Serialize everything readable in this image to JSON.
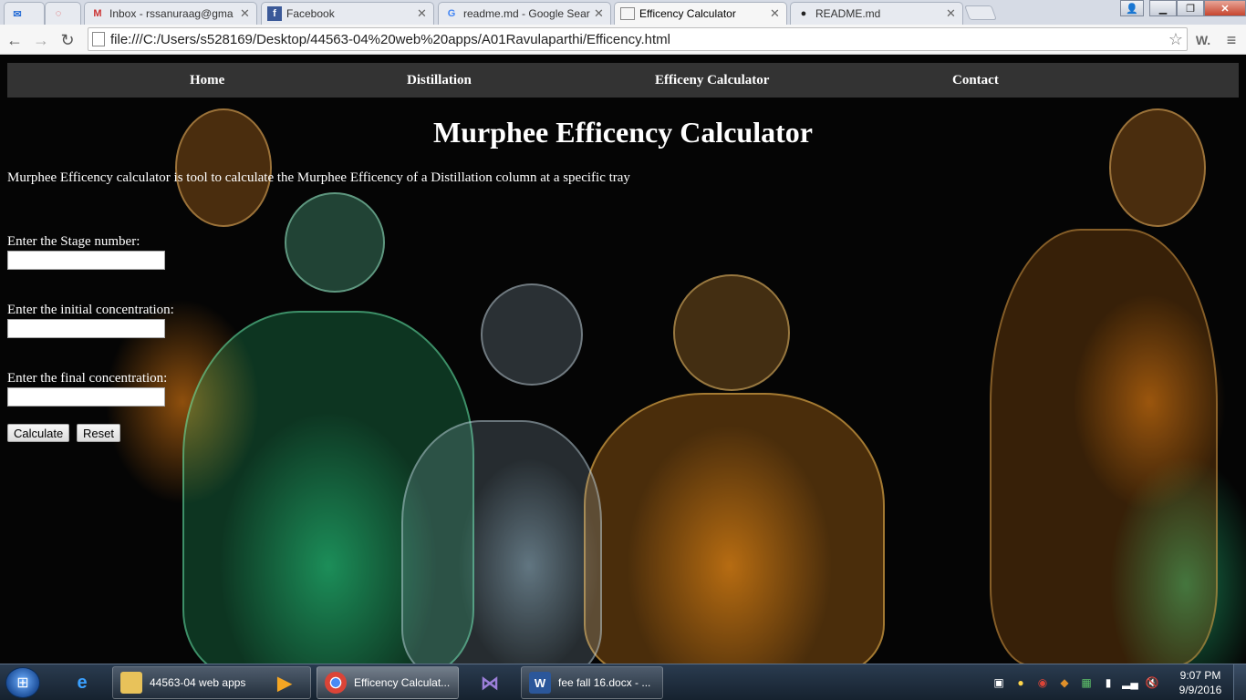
{
  "browser": {
    "tabs": [
      {
        "label": "",
        "icon": "mail-icon"
      },
      {
        "label": "",
        "icon": "loading-icon"
      },
      {
        "label": "Inbox - rssanuraag@gma",
        "icon": "gmail-icon"
      },
      {
        "label": "Facebook",
        "icon": "facebook-icon"
      },
      {
        "label": "readme.md - Google Sear",
        "icon": "google-icon"
      },
      {
        "label": "Efficency Calculator",
        "icon": "page-icon",
        "active": true
      },
      {
        "label": "README.md",
        "icon": "github-icon"
      }
    ],
    "url": "file:///C:/Users/s528169/Desktop/44563-04%20web%20apps/A01Ravulaparthi/Efficency.html",
    "extension_label": "W."
  },
  "nav": {
    "items": [
      "Home",
      "Distillation",
      "Efficeny Calculator",
      "Contact"
    ]
  },
  "page": {
    "title": "Murphee Efficency Calculator",
    "intro": "Murphee Efficency calculator is tool to calculate the Murphee Efficency of a Distillation column at a specific tray",
    "fields": [
      {
        "label": "Enter the Stage number:",
        "value": ""
      },
      {
        "label": "Enter the initial concentration:",
        "value": ""
      },
      {
        "label": "Enter the final concentration:",
        "value": ""
      }
    ],
    "calculate_label": "Calculate",
    "reset_label": "Reset"
  },
  "taskbar": {
    "items": [
      {
        "label": "44563-04 web apps",
        "icon": "folder-icon"
      },
      {
        "label": "Efficency Calculat...",
        "icon": "chrome-icon",
        "active": true
      },
      {
        "label": "fee fall 16.docx - ...",
        "icon": "word-icon"
      }
    ],
    "time": "9:07 PM",
    "date": "9/9/2016"
  },
  "colors": {
    "nav_background": "#333333",
    "page_background": "#000000",
    "text": "#ffffff"
  }
}
